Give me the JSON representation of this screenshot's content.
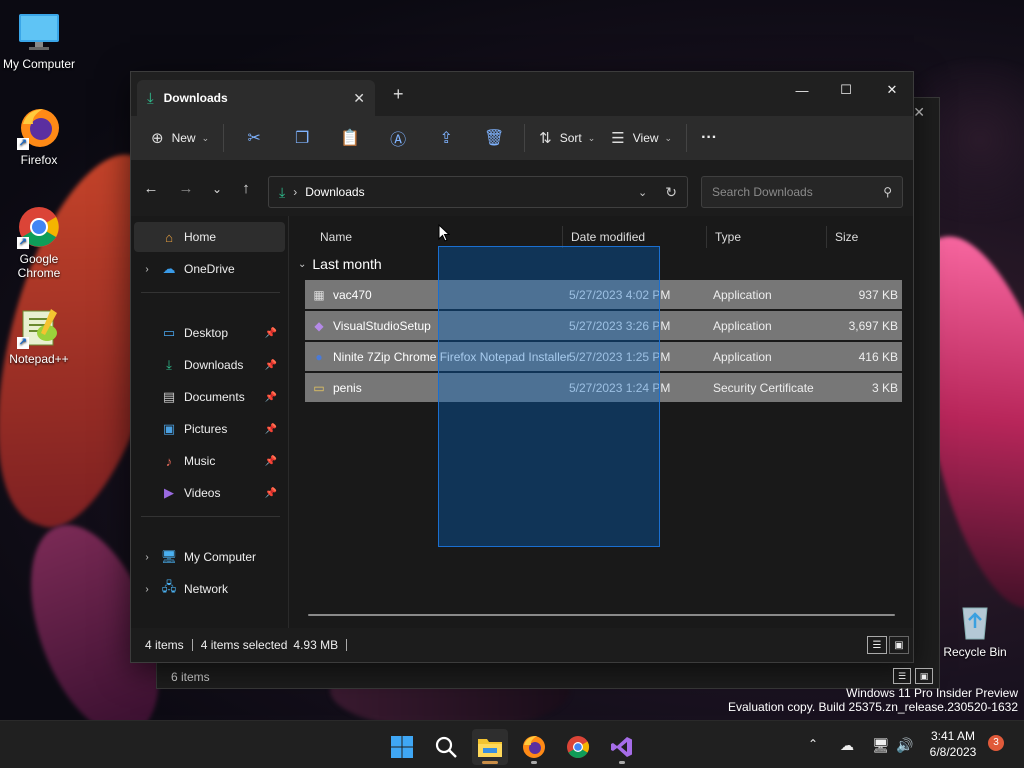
{
  "desktop": {
    "icons": [
      {
        "label": "My Computer"
      },
      {
        "label": "Firefox"
      },
      {
        "label": "Google Chrome"
      },
      {
        "label": "Notepad++"
      },
      {
        "label": "Recycle Bin"
      }
    ]
  },
  "background_window": {
    "status": "6 items"
  },
  "window": {
    "tab_title": "Downloads",
    "toolbar": {
      "new_label": "New",
      "sort_label": "Sort",
      "view_label": "View",
      "more_label": "···"
    },
    "address": {
      "location": "Downloads",
      "search_placeholder": "Search Downloads"
    },
    "sidebar": {
      "items": [
        {
          "label": "Home"
        },
        {
          "label": "OneDrive"
        },
        {
          "label": "Desktop"
        },
        {
          "label": "Downloads"
        },
        {
          "label": "Documents"
        },
        {
          "label": "Pictures"
        },
        {
          "label": "Music"
        },
        {
          "label": "Videos"
        },
        {
          "label": "My Computer"
        },
        {
          "label": "Network"
        }
      ]
    },
    "columns": {
      "name": "Name",
      "date": "Date modified",
      "type": "Type",
      "size": "Size"
    },
    "group_label": "Last month",
    "files": [
      {
        "name": "vac470",
        "date": "5/27/2023 4:02 PM",
        "type": "Application",
        "size": "937 KB"
      },
      {
        "name": "VisualStudioSetup",
        "date": "5/27/2023 3:26 PM",
        "type": "Application",
        "size": "3,697 KB"
      },
      {
        "name": "Ninite 7Zip Chrome Firefox Notepad Installer",
        "date": "5/27/2023 1:25 PM",
        "type": "Application",
        "size": "416 KB"
      },
      {
        "name": "penis",
        "date": "5/27/2023 1:24 PM",
        "type": "Security Certificate",
        "size": "3 KB"
      }
    ],
    "status": {
      "items": "4 items",
      "selected": "4 items selected",
      "size": "4.93 MB"
    }
  },
  "watermark": {
    "line1": "Windows 11 Pro Insider Preview",
    "line2": "Evaluation copy. Build 25375.zn_release.230520-1632"
  },
  "taskbar": {
    "time": "3:41 AM",
    "date": "6/8/2023",
    "notification_count": "3"
  }
}
